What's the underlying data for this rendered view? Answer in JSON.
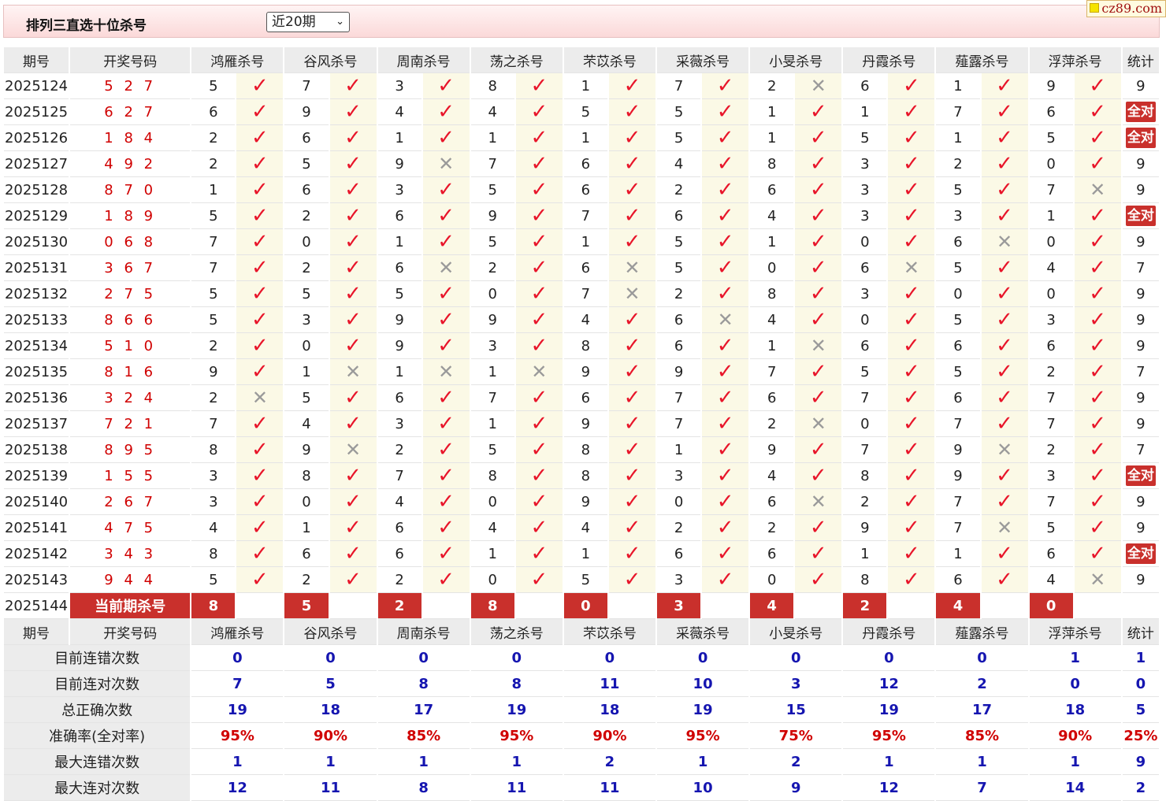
{
  "header": {
    "title": "排列三直选十位杀号",
    "period_select": "近20期",
    "watermark": "cz89.com"
  },
  "columns": {
    "period": "期号",
    "draw": "开奖号码",
    "experts": [
      "鸿雁杀号",
      "谷风杀号",
      "周南杀号",
      "荡之杀号",
      "芣苡杀号",
      "采薇杀号",
      "小旻杀号",
      "丹霞杀号",
      "薤露杀号",
      "浮萍杀号"
    ],
    "count": "统计"
  },
  "rows": [
    {
      "period": "2025124",
      "draw": "5 2 7",
      "picks": [
        5,
        7,
        3,
        8,
        1,
        7,
        2,
        6,
        1,
        9
      ],
      "hits": [
        1,
        1,
        1,
        1,
        1,
        1,
        0,
        1,
        1,
        1
      ],
      "count": "9"
    },
    {
      "period": "2025125",
      "draw": "6 2 7",
      "picks": [
        6,
        9,
        4,
        4,
        5,
        5,
        1,
        1,
        7,
        6
      ],
      "hits": [
        1,
        1,
        1,
        1,
        1,
        1,
        1,
        1,
        1,
        1
      ],
      "count": "全对"
    },
    {
      "period": "2025126",
      "draw": "1 8 4",
      "picks": [
        2,
        6,
        1,
        1,
        1,
        5,
        1,
        5,
        1,
        5
      ],
      "hits": [
        1,
        1,
        1,
        1,
        1,
        1,
        1,
        1,
        1,
        1
      ],
      "count": "全对"
    },
    {
      "period": "2025127",
      "draw": "4 9 2",
      "picks": [
        2,
        5,
        9,
        7,
        6,
        4,
        8,
        3,
        2,
        0
      ],
      "hits": [
        1,
        1,
        0,
        1,
        1,
        1,
        1,
        1,
        1,
        1
      ],
      "count": "9"
    },
    {
      "period": "2025128",
      "draw": "8 7 0",
      "picks": [
        1,
        6,
        3,
        5,
        6,
        2,
        6,
        3,
        5,
        7
      ],
      "hits": [
        1,
        1,
        1,
        1,
        1,
        1,
        1,
        1,
        1,
        0
      ],
      "count": "9"
    },
    {
      "period": "2025129",
      "draw": "1 8 9",
      "picks": [
        5,
        2,
        6,
        9,
        7,
        6,
        4,
        3,
        3,
        1
      ],
      "hits": [
        1,
        1,
        1,
        1,
        1,
        1,
        1,
        1,
        1,
        1
      ],
      "count": "全对"
    },
    {
      "period": "2025130",
      "draw": "0 6 8",
      "picks": [
        7,
        0,
        1,
        5,
        1,
        5,
        1,
        0,
        6,
        0
      ],
      "hits": [
        1,
        1,
        1,
        1,
        1,
        1,
        1,
        1,
        0,
        1
      ],
      "count": "9"
    },
    {
      "period": "2025131",
      "draw": "3 6 7",
      "picks": [
        7,
        2,
        6,
        2,
        6,
        5,
        0,
        6,
        5,
        4
      ],
      "hits": [
        1,
        1,
        0,
        1,
        0,
        1,
        1,
        0,
        1,
        1
      ],
      "count": "7"
    },
    {
      "period": "2025132",
      "draw": "2 7 5",
      "picks": [
        5,
        5,
        5,
        0,
        7,
        2,
        8,
        3,
        0,
        0
      ],
      "hits": [
        1,
        1,
        1,
        1,
        0,
        1,
        1,
        1,
        1,
        1
      ],
      "count": "9"
    },
    {
      "period": "2025133",
      "draw": "8 6 6",
      "picks": [
        5,
        3,
        9,
        9,
        4,
        6,
        4,
        0,
        5,
        3
      ],
      "hits": [
        1,
        1,
        1,
        1,
        1,
        0,
        1,
        1,
        1,
        1
      ],
      "count": "9"
    },
    {
      "period": "2025134",
      "draw": "5 1 0",
      "picks": [
        2,
        0,
        9,
        3,
        8,
        6,
        1,
        6,
        6,
        6
      ],
      "hits": [
        1,
        1,
        1,
        1,
        1,
        1,
        0,
        1,
        1,
        1
      ],
      "count": "9"
    },
    {
      "period": "2025135",
      "draw": "8 1 6",
      "picks": [
        9,
        1,
        1,
        1,
        9,
        9,
        7,
        5,
        5,
        2
      ],
      "hits": [
        1,
        0,
        0,
        0,
        1,
        1,
        1,
        1,
        1,
        1
      ],
      "count": "7"
    },
    {
      "period": "2025136",
      "draw": "3 2 4",
      "picks": [
        2,
        5,
        6,
        7,
        6,
        7,
        6,
        7,
        6,
        7
      ],
      "hits": [
        0,
        1,
        1,
        1,
        1,
        1,
        1,
        1,
        1,
        1
      ],
      "count": "9"
    },
    {
      "period": "2025137",
      "draw": "7 2 1",
      "picks": [
        7,
        4,
        3,
        1,
        9,
        7,
        2,
        0,
        7,
        7
      ],
      "hits": [
        1,
        1,
        1,
        1,
        1,
        1,
        0,
        1,
        1,
        1
      ],
      "count": "9"
    },
    {
      "period": "2025138",
      "draw": "8 9 5",
      "picks": [
        8,
        9,
        2,
        5,
        8,
        1,
        9,
        7,
        9,
        2
      ],
      "hits": [
        1,
        0,
        1,
        1,
        1,
        1,
        1,
        1,
        0,
        1
      ],
      "count": "7"
    },
    {
      "period": "2025139",
      "draw": "1 5 5",
      "picks": [
        3,
        8,
        7,
        8,
        8,
        3,
        4,
        8,
        9,
        3
      ],
      "hits": [
        1,
        1,
        1,
        1,
        1,
        1,
        1,
        1,
        1,
        1
      ],
      "count": "全对"
    },
    {
      "period": "2025140",
      "draw": "2 6 7",
      "picks": [
        3,
        0,
        4,
        0,
        9,
        0,
        6,
        2,
        7,
        7
      ],
      "hits": [
        1,
        1,
        1,
        1,
        1,
        1,
        0,
        1,
        1,
        1
      ],
      "count": "9"
    },
    {
      "period": "2025141",
      "draw": "4 7 5",
      "picks": [
        4,
        1,
        6,
        4,
        4,
        2,
        2,
        9,
        7,
        5
      ],
      "hits": [
        1,
        1,
        1,
        1,
        1,
        1,
        1,
        1,
        0,
        1
      ],
      "count": "9"
    },
    {
      "period": "2025142",
      "draw": "3 4 3",
      "picks": [
        8,
        6,
        6,
        1,
        1,
        6,
        6,
        1,
        1,
        6
      ],
      "hits": [
        1,
        1,
        1,
        1,
        1,
        1,
        1,
        1,
        1,
        1
      ],
      "count": "全对"
    },
    {
      "period": "2025143",
      "draw": "9 4 4",
      "picks": [
        5,
        2,
        2,
        0,
        5,
        3,
        0,
        8,
        6,
        4
      ],
      "hits": [
        1,
        1,
        1,
        1,
        1,
        1,
        1,
        1,
        1,
        0
      ],
      "count": "9"
    }
  ],
  "current": {
    "period": "2025144",
    "label": "当前期杀号",
    "picks": [
      8,
      5,
      2,
      8,
      0,
      3,
      4,
      2,
      4,
      0
    ]
  },
  "stats": [
    {
      "label": "目前连错次数",
      "values": [
        "0",
        "0",
        "0",
        "0",
        "0",
        "0",
        "0",
        "0",
        "0",
        "1"
      ],
      "count": "1"
    },
    {
      "label": "目前连对次数",
      "values": [
        "7",
        "5",
        "8",
        "8",
        "11",
        "10",
        "3",
        "12",
        "2",
        "0"
      ],
      "count": "0"
    },
    {
      "label": "总正确次数",
      "values": [
        "19",
        "18",
        "17",
        "19",
        "18",
        "19",
        "15",
        "19",
        "17",
        "18"
      ],
      "count": "5"
    },
    {
      "label": "准确率(全对率)",
      "values": [
        "95%",
        "90%",
        "85%",
        "95%",
        "90%",
        "95%",
        "75%",
        "95%",
        "85%",
        "90%"
      ],
      "count": "25%"
    },
    {
      "label": "最大连错次数",
      "values": [
        "1",
        "1",
        "1",
        "1",
        "2",
        "1",
        "2",
        "1",
        "1",
        "1"
      ],
      "count": "9"
    },
    {
      "label": "最大连对次数",
      "values": [
        "12",
        "11",
        "8",
        "11",
        "11",
        "10",
        "9",
        "12",
        "7",
        "14"
      ],
      "count": "2"
    }
  ],
  "icons": {
    "hit": "check-icon",
    "miss": "cross-icon"
  },
  "colors": {
    "accent": "#c9302c",
    "hit": "#e8152a",
    "miss": "#9a9a9a",
    "stat": "#1515b0",
    "rate": "#d00000"
  }
}
